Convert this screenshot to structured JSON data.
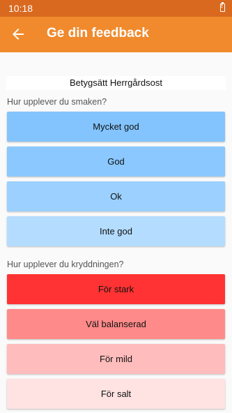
{
  "status_bar": {
    "time": "10:18"
  },
  "app_bar": {
    "title": "Ge din feedback"
  },
  "product": {
    "label": "Betygsätt Herrgårdsost"
  },
  "taste": {
    "question": "Hur upplever du smaken?",
    "options": [
      {
        "label": "Mycket god",
        "color": "#83c4ff"
      },
      {
        "label": "God",
        "color": "#8ac8ff"
      },
      {
        "label": "Ok",
        "color": "#9bd0ff"
      },
      {
        "label": "Inte god",
        "color": "#b4dcff"
      }
    ]
  },
  "spice": {
    "question": "Hur upplever du kryddningen?",
    "options": [
      {
        "label": "För stark",
        "color": "#ff3333"
      },
      {
        "label": "Väl balanserad",
        "color": "#ff8a8a"
      },
      {
        "label": "För mild",
        "color": "#ffbcbc"
      },
      {
        "label": "För salt",
        "color": "#ffe2e2"
      }
    ]
  }
}
